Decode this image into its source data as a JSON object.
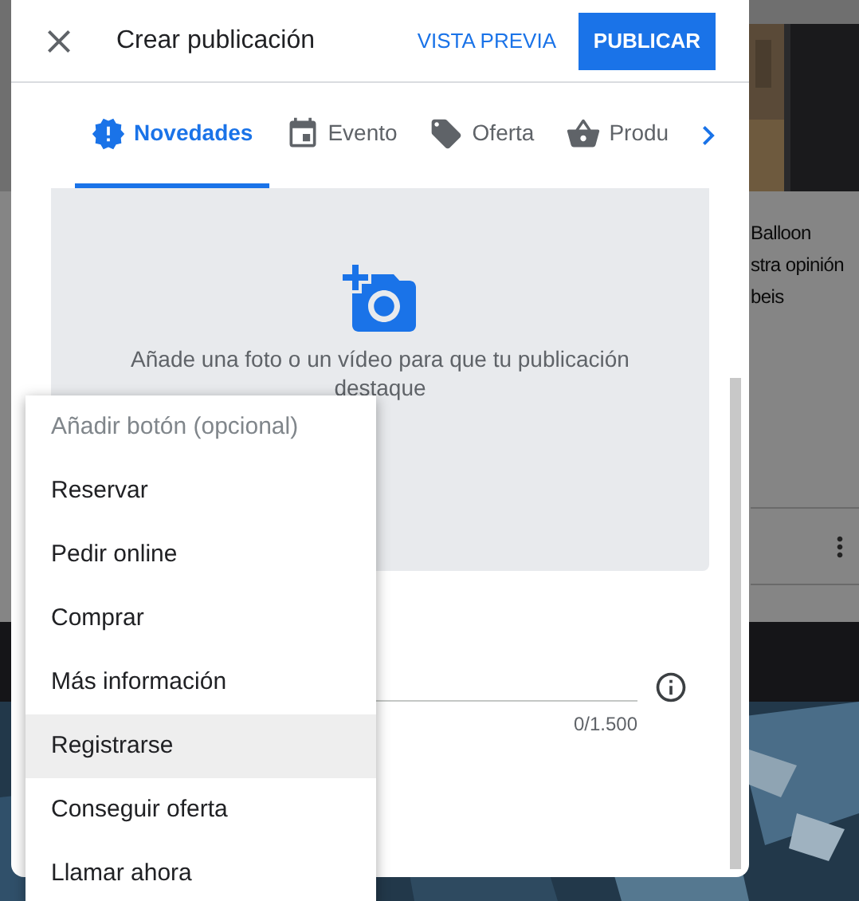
{
  "background": {
    "card_lines": [
      "Balloon",
      "stra opinión",
      "beis"
    ]
  },
  "dialog": {
    "title": "Crear publicación",
    "preview_button": "VISTA PREVIA",
    "publish_button": "PUBLICAR",
    "tabs": [
      {
        "label": "Novedades",
        "kind": "news",
        "selected": true
      },
      {
        "label": "Evento",
        "kind": "event",
        "selected": false
      },
      {
        "label": "Oferta",
        "kind": "offer",
        "selected": false
      },
      {
        "label": "Produ",
        "kind": "product",
        "selected": false
      }
    ],
    "photo_prompt": "Añade una foto o un vídeo para que tu publicación destaque",
    "counter": "0/1.500"
  },
  "menu": {
    "header": "Añadir botón (opcional)",
    "items": [
      {
        "label": "Reservar",
        "highlighted": false
      },
      {
        "label": "Pedir online",
        "highlighted": false
      },
      {
        "label": "Comprar",
        "highlighted": false
      },
      {
        "label": "Más información",
        "highlighted": false
      },
      {
        "label": "Registrarse",
        "highlighted": true
      },
      {
        "label": "Conseguir oferta",
        "highlighted": false
      },
      {
        "label": "Llamar ahora",
        "highlighted": false
      }
    ]
  }
}
